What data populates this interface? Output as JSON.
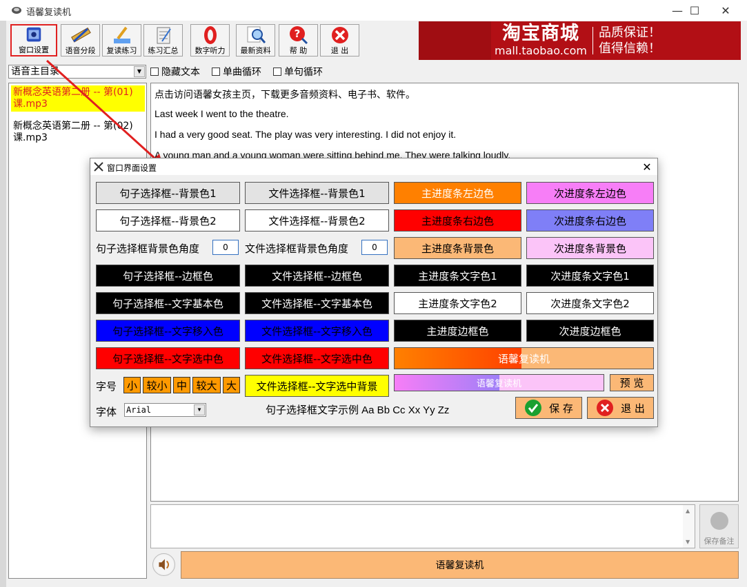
{
  "window": {
    "title": "语馨复读机",
    "minimize": "—",
    "maximize": "☐",
    "close": "✕"
  },
  "toolbar": [
    {
      "label": "窗口设置",
      "icon": "window-settings-icon"
    },
    {
      "label": "语音分段",
      "icon": "ruler-pencil-icon"
    },
    {
      "label": "复读练习",
      "icon": "brush-icon"
    },
    {
      "label": "练习汇总",
      "icon": "notebook-icon"
    },
    {
      "label": "数字听力",
      "icon": "zero-digit-icon"
    },
    {
      "label": "最新资料",
      "icon": "magnifier-icon"
    },
    {
      "label": "帮 助",
      "icon": "help-icon"
    },
    {
      "label": "退 出",
      "icon": "exit-icon"
    }
  ],
  "ad": {
    "brand": "淘宝商城",
    "url": "mall.taobao.com",
    "slogan1": "品质保证！",
    "slogan2": "值得信赖！"
  },
  "directory": {
    "value": "语音主目录"
  },
  "options": [
    "隐藏文本",
    "单曲循环",
    "单句循环"
  ],
  "files": [
    "新概念英语第二册 -- 第(01)课.mp3",
    "新概念英语第二册 -- 第(02)课.mp3"
  ],
  "text_lines": [
    "点击访问语馨女孩主页，下载更多音频资料、电子书、软件。",
    "Last week I went to the theatre.",
    "I had a very good seat. The play was very interesting. I did not enjoy it.",
    "A young man and a young woman were sitting behind me. They were talking loudly."
  ],
  "save_note": "保存备注",
  "main_progress": "语馨复读机",
  "dialog": {
    "title": "窗口界面设置",
    "close": "✕",
    "col1": [
      "句子选择框--背景色1",
      "句子选择框--背景色2",
      "句子选择框--边框色",
      "句子选择框--文字基本色",
      "句子选择框--文字移入色",
      "句子选择框--文字选中色"
    ],
    "col2": [
      "文件选择框--背景色1",
      "文件选择框--背景色2",
      "文件选择框--边框色",
      "文件选择框--文字基本色",
      "文件选择框--文字移入色",
      "文件选择框--文字选中色"
    ],
    "col3": [
      "主进度条左边色",
      "主进度条右边色",
      "主进度条背景色",
      "主进度条文字色1",
      "主进度条文字色2",
      "主进度边框色"
    ],
    "col4": [
      "次进度条左边色",
      "次进度条右边色",
      "次进度条背景色",
      "次进度条文字色1",
      "次进度条文字色2",
      "次进度边框色"
    ],
    "angle1_label": "句子选择框背景色角度",
    "angle1_value": "0",
    "angle2_label": "文件选择框背景色角度",
    "angle2_value": "0",
    "font_size_label": "字号",
    "font_sizes": [
      "小",
      "较小",
      "中",
      "较大",
      "大"
    ],
    "file_selected_bg": "文件选择框--文字选中背景",
    "main_progress_preview": "语馨复读机",
    "sub_progress_preview": "语馨复读机",
    "preview_button": "预 览",
    "font_label": "字体",
    "font_value": "Arial",
    "sample_text": "句子选择框文字示例 Aa Bb Cc Xx Yy Zz",
    "save_button": "保 存",
    "exit_button": "退 出",
    "main_progress_fraction": 0.49,
    "sub_progress_fraction": 0.5
  },
  "colors": {
    "orange": "#ff8000",
    "red": "#ff0000",
    "light_orange": "#fbb876",
    "pink": "#f77ef7",
    "periwinkle": "#7f7ff7",
    "light_pink": "#fbc4f8",
    "blue": "#0000ff",
    "yellow": "#ffff00",
    "black": "#000000",
    "ad_red": "#b20f15"
  }
}
